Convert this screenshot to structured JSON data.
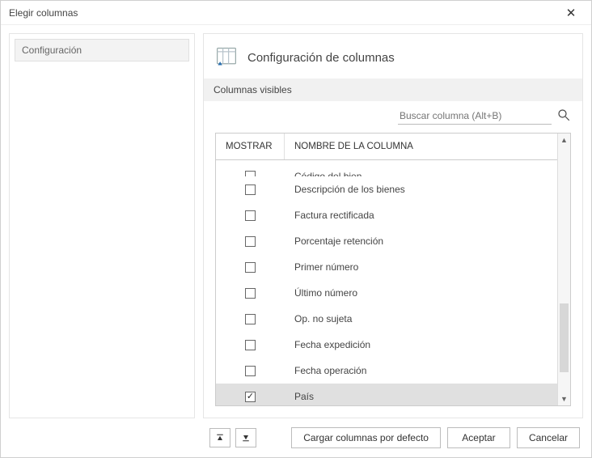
{
  "window": {
    "title": "Elegir columnas"
  },
  "sidebar": {
    "items": [
      {
        "label": "Configuración"
      }
    ]
  },
  "panel": {
    "title": "Configuración de columnas",
    "section_label": "Columnas visibles"
  },
  "search": {
    "placeholder": "Buscar columna (Alt+B)"
  },
  "table": {
    "headers": {
      "show": "Mostrar",
      "name": "Nombre de la columna"
    },
    "rows": [
      {
        "label": "Código del bien",
        "checked": false,
        "selected": false,
        "truncated": true
      },
      {
        "label": "Descripción de los bienes",
        "checked": false,
        "selected": false
      },
      {
        "label": "Factura rectificada",
        "checked": false,
        "selected": false
      },
      {
        "label": "Porcentaje retención",
        "checked": false,
        "selected": false
      },
      {
        "label": "Primer número",
        "checked": false,
        "selected": false
      },
      {
        "label": "Último número",
        "checked": false,
        "selected": false
      },
      {
        "label": "Op. no sujeta",
        "checked": false,
        "selected": false
      },
      {
        "label": "Fecha expedición",
        "checked": false,
        "selected": false
      },
      {
        "label": "Fecha operación",
        "checked": false,
        "selected": false
      },
      {
        "label": "País",
        "checked": true,
        "selected": true
      }
    ]
  },
  "footer": {
    "load_defaults": "Cargar columnas por defecto",
    "accept": "Aceptar",
    "cancel": "Cancelar"
  }
}
